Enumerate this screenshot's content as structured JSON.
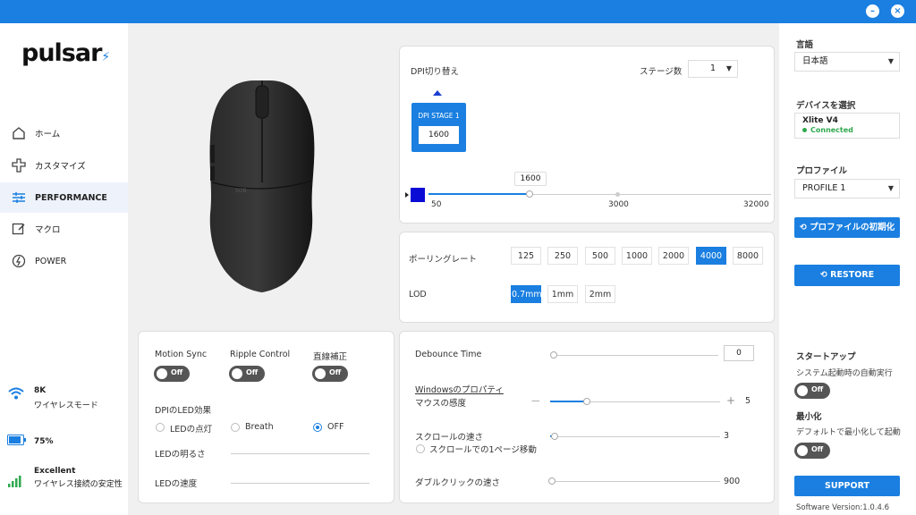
{
  "titlebar": {
    "minimize_icon": "minus-icon",
    "close_icon": "close-icon"
  },
  "sidebar": {
    "logo": "pulsar",
    "items": [
      {
        "label": "ホーム",
        "icon": "home-icon"
      },
      {
        "label": "カスタマイズ",
        "icon": "gamepad-icon"
      },
      {
        "label": "PERFORMANCE",
        "icon": "sliders-icon"
      },
      {
        "label": "マクロ",
        "icon": "edit-icon"
      },
      {
        "label": "POWER",
        "icon": "power-icon"
      }
    ],
    "status": {
      "rate": "8K",
      "mode": "ワイヤレスモード",
      "battery": "75%",
      "signal": "Excellent",
      "signal_desc": "ワイヤレス接続の安定性"
    }
  },
  "dpi": {
    "title": "DPI切り替え",
    "stage_label": "ステージ数",
    "stage_value": "1",
    "stage_card_label": "DPI STAGE 1",
    "stage_card_value": "1600",
    "slider_value": "1600",
    "slider_min": "50",
    "slider_mid": "3000",
    "slider_max": "32000",
    "color": "#0b0bd6"
  },
  "polling": {
    "label": "ポーリングレート",
    "options": [
      "125",
      "250",
      "500",
      "1000",
      "2000",
      "4000",
      "8000"
    ],
    "selected": "4000"
  },
  "lod": {
    "label": "LOD",
    "options": [
      "0.7mm",
      "1mm",
      "2mm"
    ],
    "selected": "0.7mm"
  },
  "toggles": {
    "motion_sync": "Motion Sync",
    "ripple": "Ripple Control",
    "angle": "直線補正",
    "off": "Off"
  },
  "led": {
    "title": "DPIのLED効果",
    "options": [
      "LEDの点灯",
      "Breath",
      "OFF"
    ],
    "selected": "OFF",
    "brightness": "LEDの明るさ",
    "speed": "LEDの速度"
  },
  "debounce": {
    "label": "Debounce Time",
    "value": "0"
  },
  "windows": {
    "title": "Windowsのプロパティ",
    "sensitivity": "マウスの感度",
    "sensitivity_value": "5",
    "minus": "—",
    "plus": "+",
    "scroll": "スクロールの速さ",
    "scroll_value": "3",
    "scroll_page": "スクロールでの1ページ移動",
    "dblclick": "ダブルクリックの速さ",
    "dblclick_value": "900"
  },
  "right": {
    "lang_label": "言語",
    "lang_value": "日本語",
    "device_label": "デバイスを選択",
    "device_name": "Xlite V4",
    "device_status": "Connected",
    "profile_label": "プロファイル",
    "profile_value": "PROFILE 1",
    "reset_btn": "プロファイルの初期化",
    "restore_btn": "RESTORE",
    "startup_label": "スタートアップ",
    "startup_desc": "システム起動時の自動実行",
    "minimize_label": "最小化",
    "minimize_desc": "デフォルトで最小化して起動",
    "off": "Off",
    "support_btn": "SUPPORT",
    "version": "Software Version:1.0.4.6"
  }
}
